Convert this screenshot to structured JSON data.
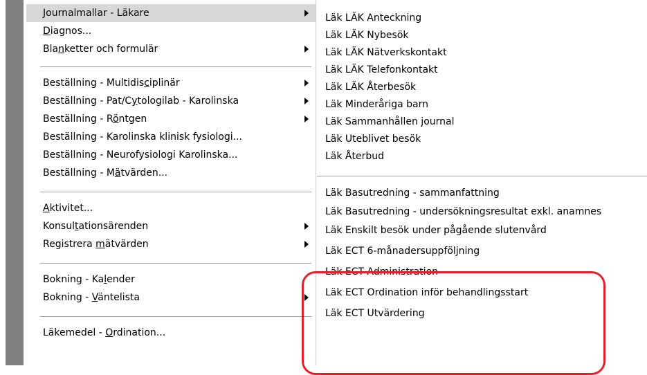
{
  "main_menu": {
    "items": [
      {
        "pre": "Journalmallar - Läkare",
        "u": "",
        "post": "",
        "arrow": true,
        "highlight": true
      },
      {
        "pre": "",
        "u": "D",
        "post": "iagnos...",
        "arrow": false
      },
      {
        "pre": "Bla",
        "u": "n",
        "post": "ketter och formulär",
        "arrow": true
      },
      {
        "pre": "Beställning - Multidis",
        "u": "c",
        "post": "iplinär",
        "arrow": true
      },
      {
        "pre": "Beställning - Pat/C",
        "u": "y",
        "post": "tologilab - Karolinska",
        "arrow": true
      },
      {
        "pre": "Beställning - R",
        "u": "ö",
        "post": "ntgen",
        "arrow": true
      },
      {
        "pre": "Beställning - Karolinska klinisk fysiologi...",
        "u": "",
        "post": "",
        "arrow": false
      },
      {
        "pre": "Beställning - Neurofysiologi Karolinska...",
        "u": "",
        "post": "",
        "arrow": false
      },
      {
        "pre": "Beställning - M",
        "u": "ä",
        "post": "tvärden...",
        "arrow": false
      },
      {
        "pre": "",
        "u": "A",
        "post": "ktivitet...",
        "arrow": false
      },
      {
        "pre": "Konsul",
        "u": "t",
        "post": "ationsärenden",
        "arrow": true
      },
      {
        "pre": "Registrera ",
        "u": "m",
        "post": "ätvärden",
        "arrow": true
      },
      {
        "pre": "Bokning - Ka",
        "u": "l",
        "post": "ender",
        "arrow": false
      },
      {
        "pre": "Bokning - ",
        "u": "V",
        "post": "äntelista",
        "arrow": true
      },
      {
        "pre": "Läkemedel - ",
        "u": "O",
        "post": "rdination...",
        "arrow": false
      }
    ]
  },
  "submenu": {
    "items": [
      "Läk LÄK Anteckning",
      "Läk LÄK Nybesök",
      "Läk LÄK Nätverkskontakt",
      "Läk LÄK Telefonkontakt",
      "Läk LÄK Återbesök",
      "Läk Minderåriga barn",
      "Läk Sammanhållen journal",
      "Läk Uteblivet besök",
      "Läk Återbud",
      "Läk Basutredning - sammanfattning",
      "Läk Basutredning - undersökningsresultat exkl. anamnes",
      "Läk Enskilt besök under pågående slutenvård",
      "Läk ECT 6-månadersuppföljning",
      "Läk ECT Administration",
      "Läk ECT Ordination inför behandlingsstart",
      "Läk ECT Utvärdering"
    ]
  },
  "colors": {
    "highlight": "#d8d8d8",
    "left_bar": "#808080",
    "callout": "#e8202a"
  }
}
